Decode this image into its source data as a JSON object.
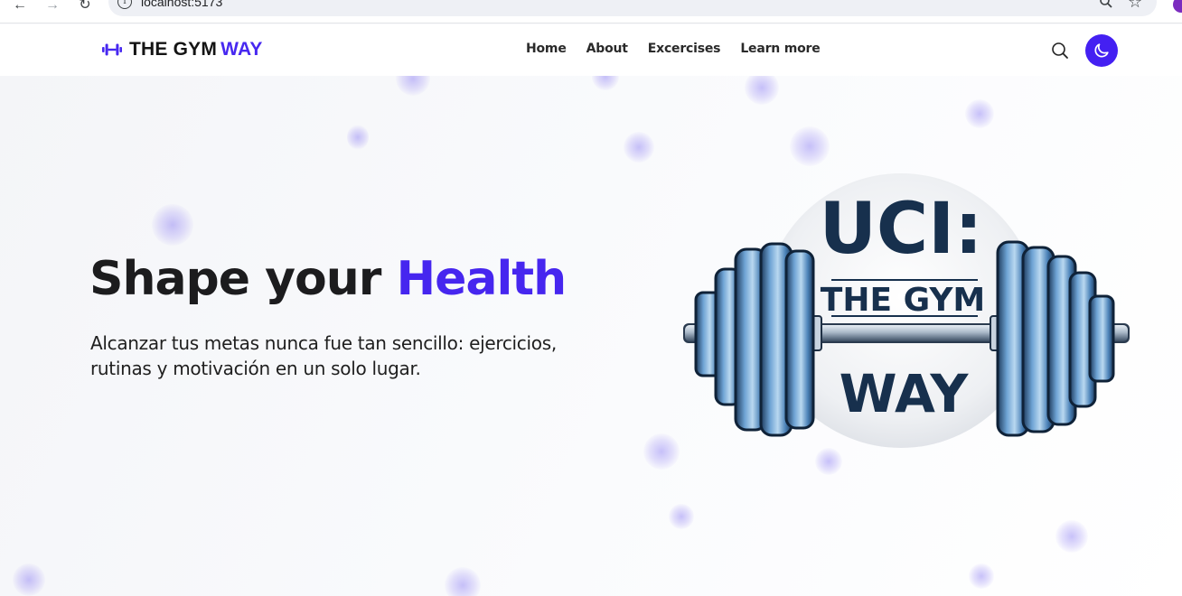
{
  "browser": {
    "url": "localhost:5173"
  },
  "header": {
    "brand_main": "THE GYM",
    "brand_accent": "WAY",
    "nav": [
      "Home",
      "About",
      "Excercises",
      "Learn more"
    ]
  },
  "hero": {
    "headline_main": "Shape your",
    "headline_accent": "Health",
    "subtitle": "Alcanzar tus metas nunca fue tan sencillo: ejercicios, rutinas y motivación en un solo lugar."
  },
  "logo": {
    "line1": "UCI:",
    "line2": "THE GYM",
    "line3": "WAY"
  },
  "colors": {
    "accent": "#4626ef",
    "dumbbell_blue": "#5a8fc4",
    "dark_navy": "#17304d"
  },
  "icons": {
    "back": "arrow-left-icon",
    "forward": "arrow-right-icon",
    "reload": "reload-icon",
    "info": "info-icon",
    "zoom": "magnifier-icon",
    "bookmark": "star-icon",
    "brand": "dumbbell-icon",
    "search": "search-icon",
    "theme": "moon-icon"
  }
}
